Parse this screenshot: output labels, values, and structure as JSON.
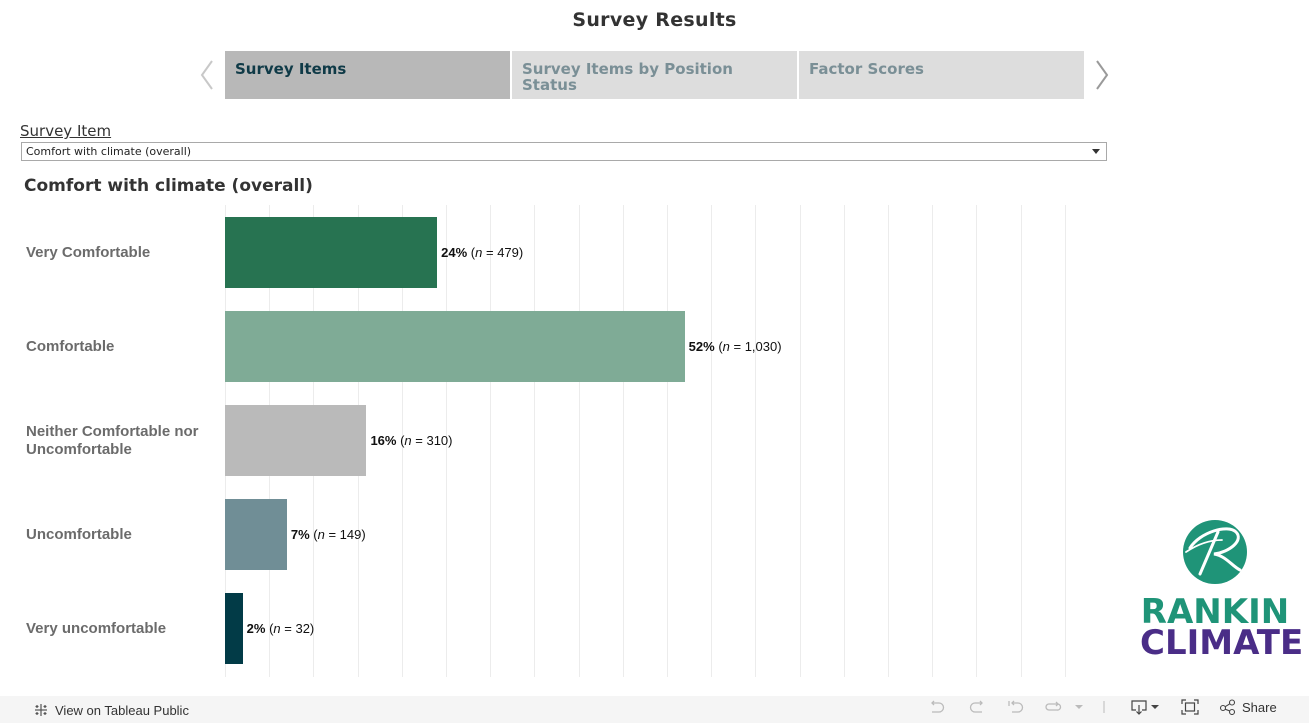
{
  "header": {
    "title": "Survey Results"
  },
  "navigation": {
    "prev_icon": "chevron-left-icon",
    "next_icon": "chevron-right-icon",
    "tabs": [
      {
        "label": "Survey Items",
        "active": true
      },
      {
        "label": "Survey Items by Position Status",
        "active": false
      },
      {
        "label": "Factor Scores",
        "active": false
      }
    ]
  },
  "filter": {
    "label": "Survey Item",
    "selected": "Comfort with climate (overall)",
    "icon": "dropdown-caret-icon"
  },
  "chart_data": {
    "type": "bar",
    "orientation": "horizontal",
    "title": "Comfort with climate (overall)",
    "categories": [
      "Very Comfortable",
      "Comfortable",
      "Neither Comfortable nor Uncomfortable",
      "Uncomfortable",
      "Very uncomfortable"
    ],
    "values": [
      24,
      52,
      16,
      7,
      2
    ],
    "counts": [
      479,
      1030,
      310,
      149,
      32
    ],
    "value_labels": [
      "24%",
      "52%",
      "16%",
      "7%",
      "2%"
    ],
    "count_labels": [
      "479",
      "1,030",
      "310",
      "149",
      "32"
    ],
    "colors": [
      "#277351",
      "#7fab96",
      "#bababa",
      "#708e96",
      "#023b47"
    ],
    "xlabel": "",
    "ylabel": "",
    "xlim": [
      0,
      95
    ],
    "grid_step": 5,
    "grid": true,
    "legend": "none",
    "n_prefix": "n",
    "n_equals": " = "
  },
  "logo": {
    "line1": "RANKIN",
    "line2": "CLIMATE",
    "primary_color": "#1f9478",
    "secondary_color": "#4a2d87"
  },
  "footer": {
    "view_on_label": "View on Tableau Public",
    "share_label": "Share",
    "tools": [
      "undo-icon",
      "redo-icon",
      "revert-icon",
      "refresh-icon",
      "pause-dropdown-icon",
      "download-icon",
      "fullscreen-icon",
      "share-icon"
    ]
  }
}
